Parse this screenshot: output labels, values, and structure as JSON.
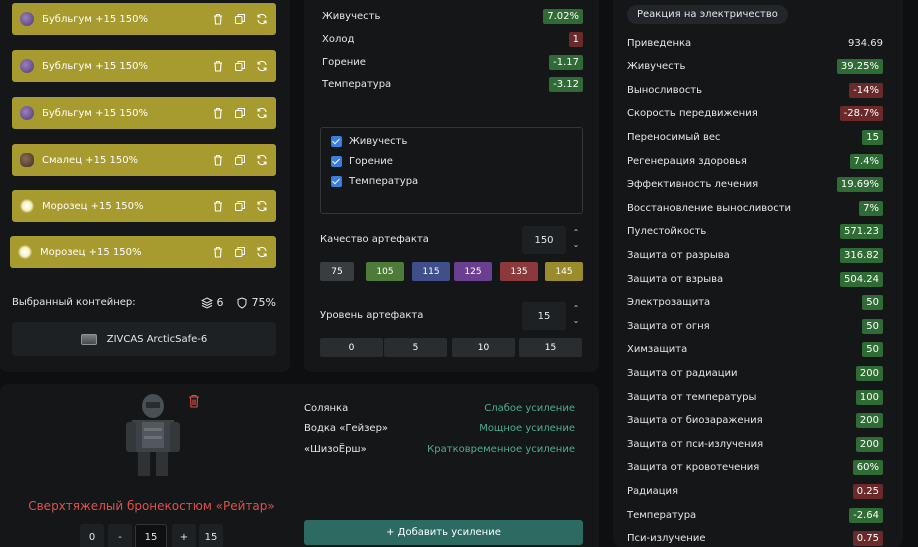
{
  "artifacts": [
    {
      "label": "Бубльгум +15 150%",
      "icon": "purple-artifact-icon"
    },
    {
      "label": "Бубльгум +15 150%",
      "icon": "purple-artifact-icon"
    },
    {
      "label": "Бубльгум +15 150%",
      "icon": "purple-artifact-icon"
    },
    {
      "label": "Смалец +15 150%",
      "icon": "brown-artifact-icon"
    },
    {
      "label": "Морозец +15 150%",
      "icon": "white-artifact-icon"
    },
    {
      "label": "Морозец +15 150%",
      "icon": "white-artifact-icon"
    }
  ],
  "container": {
    "label": "Выбранный контейнер:",
    "slots": "6",
    "protection": "75%",
    "name": "ZIVCAS ArcticSafe-6"
  },
  "stats": [
    {
      "name": "Живучесть",
      "value": "7.02%",
      "tone": "green"
    },
    {
      "name": "Холод",
      "value": "1",
      "tone": "red"
    },
    {
      "name": "Горение",
      "value": "-1.17",
      "tone": "green"
    },
    {
      "name": "Температура",
      "value": "-3.12",
      "tone": "green"
    }
  ],
  "filters": [
    "Живучесть",
    "Горение",
    "Температура"
  ],
  "quality": {
    "label": "Качество артефакта",
    "value": "150",
    "presets": [
      "75",
      "105",
      "115",
      "125",
      "135",
      "145"
    ],
    "preset_colors": [
      "#3a3d40",
      "#4f7b3a",
      "#3e4f8a",
      "#6b3f8f",
      "#8a3a3a",
      "#9a8c2c"
    ]
  },
  "level": {
    "label": "Уровень артефакта",
    "value": "15",
    "presets": [
      "0",
      "5",
      "10",
      "15"
    ]
  },
  "item": {
    "name": "Сверхтяжелый бронекостюм «Рейтар»",
    "counter": {
      "min": "0",
      "minus": "-",
      "value": "15",
      "plus": "+",
      "max": "15"
    },
    "boosts": [
      {
        "name": "Солянка",
        "effect": "Слабое усиление"
      },
      {
        "name": "Водка «Гейзер»",
        "effect": "Мощное усиление"
      },
      {
        "name": "«ШизоЁрш»",
        "effect": "Кратковременное усиление"
      }
    ],
    "add_button": "+ Добавить усиление"
  },
  "properties": {
    "pill": "Реакция на электричество",
    "rows": [
      {
        "name": "Приведенка",
        "value": "934.69",
        "tone": "plain"
      },
      {
        "name": "Живучесть",
        "value": "39.25%",
        "tone": "green"
      },
      {
        "name": "Выносливость",
        "value": "-14%",
        "tone": "red"
      },
      {
        "name": "Скорость передвижения",
        "value": "-28.7%",
        "tone": "red"
      },
      {
        "name": "Переносимый вес",
        "value": "15",
        "tone": "green"
      },
      {
        "name": "Регенерация здоровья",
        "value": "7.4%",
        "tone": "green"
      },
      {
        "name": "Эффективность лечения",
        "value": "19.69%",
        "tone": "green"
      },
      {
        "name": "Восстановление выносливости",
        "value": "7%",
        "tone": "green"
      },
      {
        "name": "Пулестойкость",
        "value": "571.23",
        "tone": "green"
      },
      {
        "name": "Защита от разрыва",
        "value": "316.82",
        "tone": "green"
      },
      {
        "name": "Защита от взрыва",
        "value": "504.24",
        "tone": "green"
      },
      {
        "name": "Электрозащита",
        "value": "50",
        "tone": "green"
      },
      {
        "name": "Защита от огня",
        "value": "50",
        "tone": "green"
      },
      {
        "name": "Химзащита",
        "value": "50",
        "tone": "green"
      },
      {
        "name": "Защита от радиации",
        "value": "200",
        "tone": "green"
      },
      {
        "name": "Защита от температуры",
        "value": "100",
        "tone": "green"
      },
      {
        "name": "Защита от биозаражения",
        "value": "200",
        "tone": "green"
      },
      {
        "name": "Защита от пси-излучения",
        "value": "200",
        "tone": "green"
      },
      {
        "name": "Защита от кровотечения",
        "value": "60%",
        "tone": "green"
      },
      {
        "name": "Радиация",
        "value": "0.25",
        "tone": "red"
      },
      {
        "name": "Температура",
        "value": "-2.64",
        "tone": "green"
      },
      {
        "name": "Пси-излучение",
        "value": "0.75",
        "tone": "red"
      }
    ]
  }
}
